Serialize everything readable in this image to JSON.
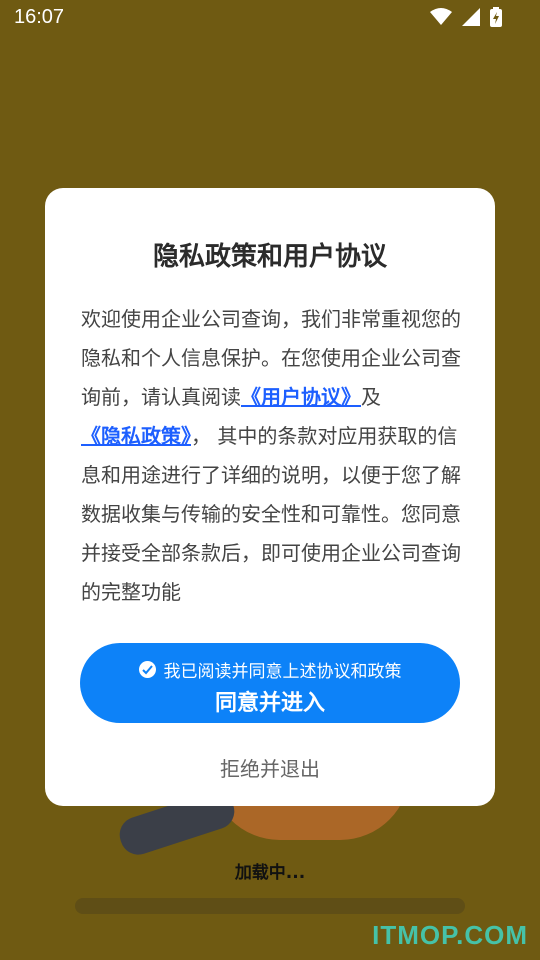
{
  "status": {
    "time": "16:07"
  },
  "dialog": {
    "title": "隐私政策和用户协议",
    "body_intro": "欢迎使用企业公司查询，我们非常重视您的隐私和个人信息保护。在您使用企业公司查询前，请认真阅读",
    "link_user_agreement": "《用户协议》",
    "connector": "及",
    "link_privacy_policy": "《隐私政策》",
    "body_rest": "， 其中的条款对应用获取的信息和用途进行了详细的说明，以便于您了解数据收集与传输的安全性和可靠性。您同意并接受全部条款后，即可使用企业公司查询的完整功能",
    "agree_check_label": "我已阅读并同意上述协议和政策",
    "agree_button_label": "同意并进入",
    "reject_label": "拒绝并退出"
  },
  "background": {
    "loading_label": "加载中...",
    "watermark": "ITMOP.COM"
  },
  "colors": {
    "background": "#6f5a12",
    "primary_button": "#0d82f8",
    "link": "#1d5fff"
  }
}
